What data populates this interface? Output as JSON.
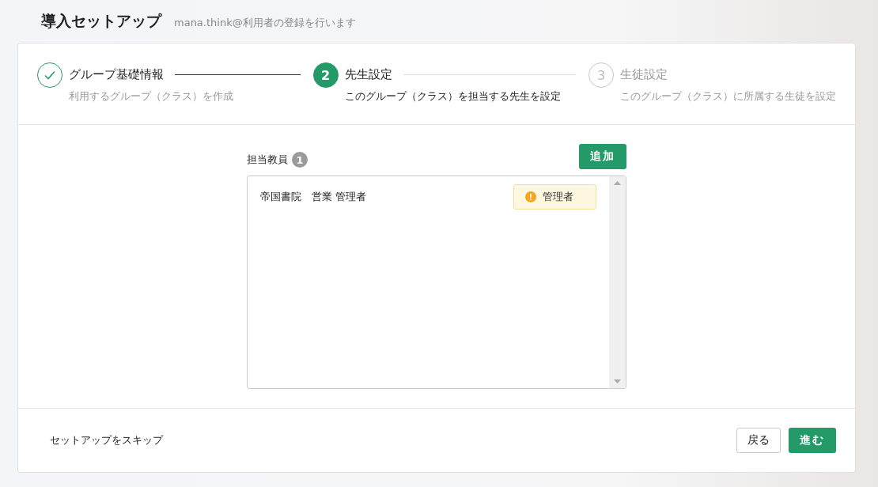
{
  "header": {
    "title": "導入セットアップ",
    "subtitle": "mana.think@利用者の登録を行います"
  },
  "steps": [
    {
      "kind": "done",
      "title": "グループ基礎情報",
      "description": "利用するグループ（クラス）を作成"
    },
    {
      "kind": "current",
      "number": "2",
      "title": "先生設定",
      "description": "このグループ（クラス）を担当する先生を設定"
    },
    {
      "kind": "pending",
      "number": "3",
      "title": "生徒設定",
      "description": "このグループ（クラス）に所属する生徒を設定"
    }
  ],
  "teachers": {
    "label": "担当教員",
    "count": "1",
    "add_button": "追加",
    "rows": [
      {
        "name": "帝国書院　営業 管理者",
        "role": "管理者"
      }
    ]
  },
  "footer": {
    "skip_link": "セットアップをスキップ",
    "back_button": "戻る",
    "next_button": "進む"
  }
}
